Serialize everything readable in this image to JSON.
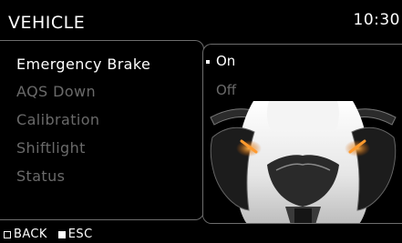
{
  "header": {
    "title": "VEHICLE",
    "time": "10:30"
  },
  "menu": {
    "items": [
      {
        "label": "Emergency Brake",
        "selected": true
      },
      {
        "label": "AQS Down",
        "selected": false
      },
      {
        "label": "Calibration",
        "selected": false
      },
      {
        "label": "Shiftlight",
        "selected": false
      },
      {
        "label": "Status",
        "selected": false
      }
    ]
  },
  "options": {
    "items": [
      {
        "label": "On",
        "selected": true
      },
      {
        "label": "Off",
        "selected": false
      }
    ]
  },
  "footer": {
    "back_label": "BACK",
    "esc_label": "ESC"
  },
  "colors": {
    "active_text": "#ffffff",
    "inactive_text": "#6a6a6a",
    "border": "#6d6d6d",
    "turn_light": "#ff9a2e"
  },
  "icons": {
    "back": "outline-square-icon",
    "esc": "filled-square-icon",
    "selection": "bullet-icon"
  }
}
